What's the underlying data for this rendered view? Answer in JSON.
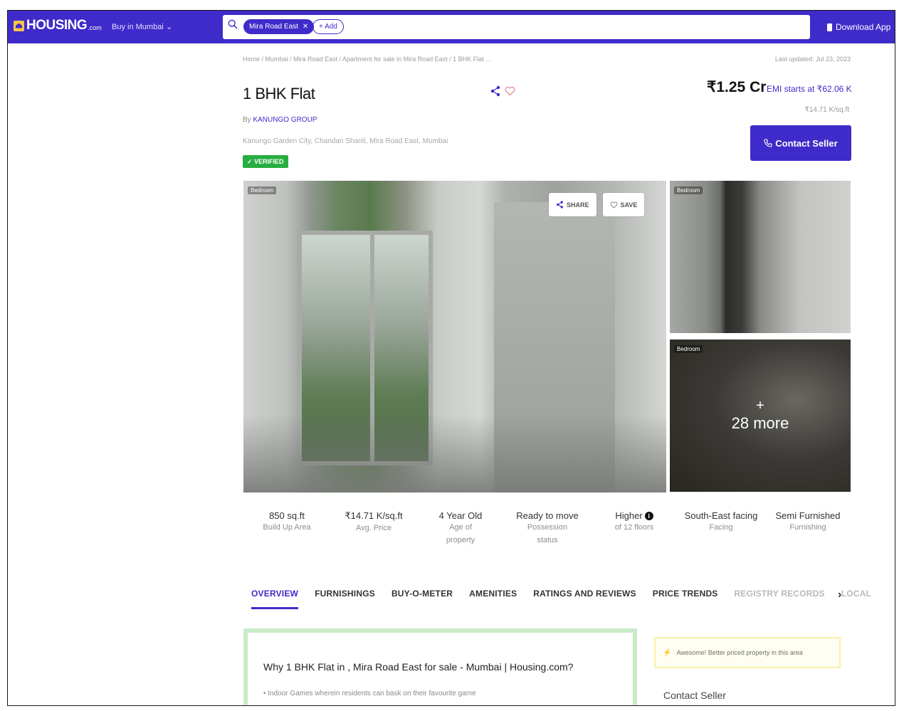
{
  "header": {
    "logo_text": "HOUSING",
    "logo_suffix": ".com",
    "city_select": "Buy in Mumbai",
    "search_chip": "Mira Road East",
    "add_chip": "+ Add",
    "download_app": "Download App"
  },
  "listing": {
    "breadcrumb": "Home / Mumbai / Mira Road East / Apartment for sale in Mira Road East / 1 BHK Flat ...",
    "last_updated": "Last updated: Jul 23, 2023",
    "title": "1 BHK Flat",
    "by_prefix": "By",
    "builder": "KANUNGO GROUP",
    "address": "Kanungo Garden City, Chandan Shanti, Mira Road East, Mumbai",
    "verified_label": "✓ VERIFIED",
    "price": "₹1.25 Cr",
    "emi": "EMI starts at ₹62.06 K",
    "price_per_sqft": "₹14.71 K/sq.ft",
    "contact_seller": "Contact Seller"
  },
  "gallery": {
    "main_tag": "Bedroom",
    "top_tag": "Bedroom",
    "bottom_tag": "Bedroom",
    "share_label": "SHARE",
    "save_label": "SAVE",
    "more_plus": "+",
    "more_label": "28 more"
  },
  "stats": [
    {
      "value": "850 sq.ft",
      "label": "Build Up Area"
    },
    {
      "value": "₹14.71 K/sq.ft",
      "label": "Avg. Price"
    },
    {
      "value": "4 Year Old",
      "label": "Age of property"
    },
    {
      "value": "Ready to move",
      "label": "Possession status"
    },
    {
      "value": "Higher",
      "label": "of 12 floors"
    },
    {
      "value": "South-East facing",
      "label": "Facing"
    },
    {
      "value": "Semi Furnished",
      "label": "Furnishing"
    }
  ],
  "tabs": [
    "OVERVIEW",
    "FURNISHINGS",
    "BUY-O-METER",
    "AMENITIES",
    "RATINGS AND REVIEWS",
    "PRICE TRENDS",
    "REGISTRY RECORDS",
    "LOCAL"
  ],
  "overview": {
    "heading": "Why 1 BHK Flat in , Mira Road East for sale - Mumbai | Housing.com?",
    "bullet": "• Indoor Games wherein residents can bask on their favourite game"
  },
  "sidebar": {
    "awesome_text": "Awesome! Better priced property in this area",
    "contact_heading": "Contact Seller"
  },
  "colors": {
    "brand": "#3f2bc9",
    "verified": "#27ae40",
    "overview_border": "#c9ebc9",
    "awesome_border": "#fbf0a8"
  }
}
